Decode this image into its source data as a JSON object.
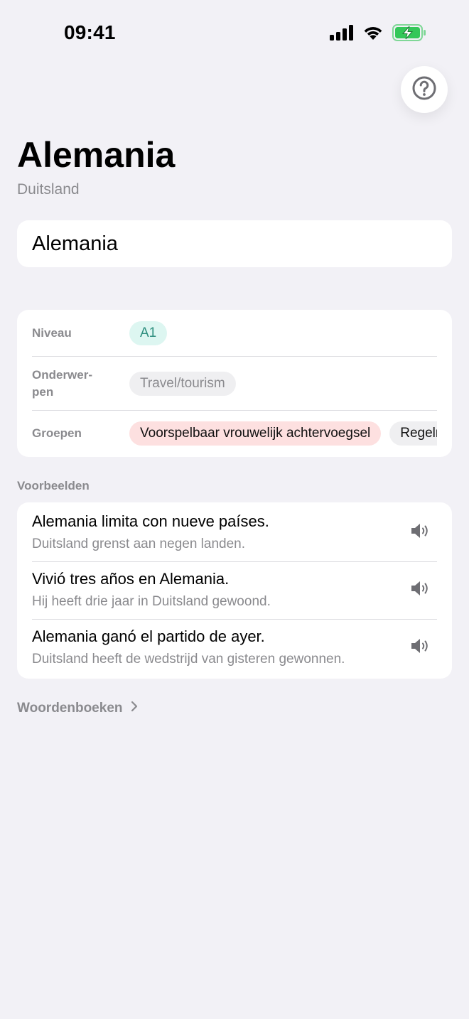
{
  "status_bar": {
    "time": "09:41"
  },
  "icons": {
    "help": "help-circle-icon",
    "signal": "cellular-signal-icon",
    "wifi": "wifi-icon",
    "battery": "battery-charging-icon",
    "speaker": "speaker-icon",
    "chevron": "chevron-right-icon"
  },
  "header": {
    "title": "Alemania",
    "subtitle": "Duitsland"
  },
  "word_card": {
    "word": "Alemania"
  },
  "info": {
    "level_label": "Niveau",
    "level_value": "A1",
    "topics_label": "Onderwer-\npen",
    "topics_value": "Travel/tourism",
    "groups_label": "Groepen",
    "groups": [
      "Voorspelbaar vrouwelijk achtervoegsel",
      "Regelmatig"
    ]
  },
  "examples": {
    "section_label": "Voorbeelden",
    "items": [
      {
        "es": "Alemania limita con nueve países.",
        "nl": "Duitsland grenst aan negen landen."
      },
      {
        "es": "Vivió tres años en Alemania.",
        "nl": "Hij heeft drie jaar in Duitsland gewoond."
      },
      {
        "es": "Alemania ganó el partido de ayer.",
        "nl": "Duitsland heeft de wedstrijd van gisteren gewonnen."
      }
    ]
  },
  "dictionaries": {
    "label": "Woordenboeken"
  },
  "colors": {
    "background": "#F2F1F6",
    "card": "#FFFFFF",
    "level_chip_bg": "#DDF6F1",
    "level_chip_text": "#2F8F7F",
    "group_chip_bg": "#FDE0E0",
    "battery_green": "#34C759"
  }
}
